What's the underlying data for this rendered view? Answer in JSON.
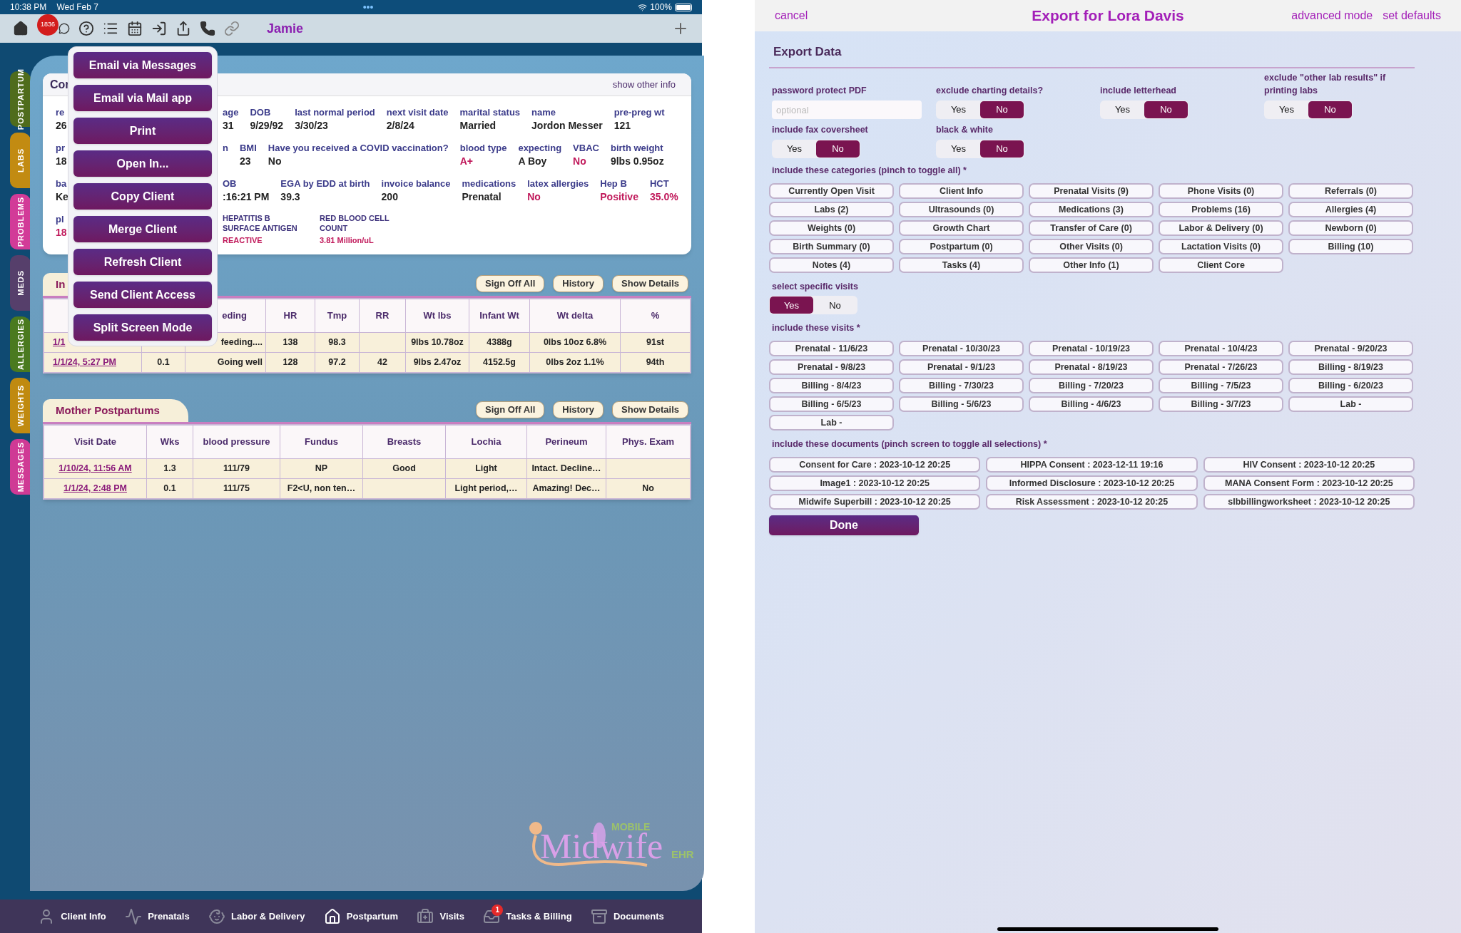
{
  "status_bar": {
    "time": "10:38 PM",
    "date": "Wed Feb 7",
    "dots": "•••",
    "battery": "100%"
  },
  "toolbar": {
    "badge": "1836",
    "user": "Jamie"
  },
  "side_tabs": [
    {
      "label": "POSTPARTUM",
      "color": "#4f6c1c"
    },
    {
      "label": "LABS",
      "color": "#c28b12"
    },
    {
      "label": "PROBLEMS",
      "color": "#d23b98"
    },
    {
      "label": "MEDS",
      "color": "#563f6b"
    },
    {
      "label": "ALLERGIES",
      "color": "#4a7a1f"
    },
    {
      "label": "WEIGHTS",
      "color": "#c08a10"
    },
    {
      "label": "MESSAGES",
      "color": "#cf3a95"
    }
  ],
  "client_card": {
    "title": "Cor",
    "link": "show other info",
    "lines": [
      [
        {
          "label": "re",
          "value": "26"
        },
        {
          "label": "age",
          "value": "31"
        },
        {
          "label": "DOB",
          "value": "9/29/92"
        },
        {
          "label": "last normal period",
          "value": "3/30/23"
        },
        {
          "label": "next visit date",
          "value": "2/8/24"
        },
        {
          "label": "marital status",
          "value": "Married"
        },
        {
          "label": "name",
          "value": "Jordon Messer"
        },
        {
          "label": "pre-preg wt",
          "value": "121"
        }
      ],
      [
        {
          "label": "pr",
          "value": "18"
        },
        {
          "label": "n"
        },
        {
          "label": "BMI",
          "value": "23"
        },
        {
          "label": "Have you received a COVID vaccination?",
          "value": "No"
        },
        {
          "label": "blood type",
          "value": "A+",
          "alert": true
        },
        {
          "label": "expecting",
          "value": "A Boy"
        },
        {
          "label": "VBAC",
          "value": "No",
          "alert": true
        },
        {
          "label": "birth weight",
          "value": "9lbs 0.95oz"
        }
      ],
      [
        {
          "label": "ba",
          "value": "Ke"
        },
        {
          "label": "OB",
          "value": ":16:21 PM"
        },
        {
          "label": "EGA by EDD at birth",
          "value": "39.3"
        },
        {
          "label": "invoice balance",
          "value": "200"
        },
        {
          "label": "medications",
          "value": "Prenatal"
        },
        {
          "label": "latex allergies",
          "value": "No",
          "alert": true
        },
        {
          "label": "Hep B",
          "value": "Positive",
          "alert": true
        },
        {
          "label": "HCT",
          "value": "35.0%",
          "alert": true
        }
      ],
      [
        {
          "label": "pl",
          "value": "18",
          "alert": true
        },
        {
          "label": "HEPATITIS B SURFACE ANTIGEN",
          "value": "REACTIVE",
          "alert": true,
          "kind": "lab"
        },
        {
          "label": "RED BLOOD CELL COUNT",
          "value": "3.81 Million/uL",
          "alert": true,
          "kind": "lab"
        }
      ]
    ]
  },
  "share_menu": [
    "Email via Messages",
    "Email via Mail app",
    "Print",
    "Open In...",
    "Copy Client",
    "Merge Client",
    "Refresh Client",
    "Send Client Access",
    "Split Screen Mode"
  ],
  "infant_table": {
    "title": "In",
    "buttons": [
      "Sign Off All",
      "History",
      "Show Details"
    ],
    "columns": [
      null,
      null,
      "eding",
      "HR",
      "Tmp",
      "RR",
      "Wt lbs",
      "Infant Wt",
      "Wt delta",
      "%"
    ],
    "rows": [
      [
        "1/1",
        null,
        "feeding....",
        "138",
        "98.3",
        null,
        "9lbs 10.78oz",
        "4388g",
        "0lbs 10oz 6.8%",
        "91st"
      ],
      [
        "1/1/24, 5:27 PM",
        "0.1",
        "Going well",
        "128",
        "97.2",
        "42",
        "9lbs 2.47oz",
        "4152.5g",
        "0lbs 2oz 1.1%",
        "94th"
      ]
    ]
  },
  "mother_table": {
    "title": "Mother Postpartums",
    "buttons": [
      "Sign Off All",
      "History",
      "Show Details"
    ],
    "columns": [
      "Visit Date",
      "Wks",
      "blood pressure",
      "Fundus",
      "Breasts",
      "Lochia",
      "Perineum",
      "Phys. Exam"
    ],
    "rows": [
      [
        "1/10/24, 11:56 AM",
        "1.3",
        "111/79",
        "NP",
        "Good",
        "Light",
        "Intact. Decline…",
        null
      ],
      [
        "1/1/24, 2:48 PM",
        "0.1",
        "111/75",
        "F2<U, non ten…",
        null,
        "Light period,…",
        "Amazing! Dec…",
        "No"
      ]
    ]
  },
  "logo": {
    "top": "MOBILE",
    "main": "Midwife",
    "side": "EHR"
  },
  "bottom_tabs": [
    {
      "label": "Client Info",
      "selected": false
    },
    {
      "label": "Prenatals",
      "selected": false
    },
    {
      "label": "Labor & Delivery",
      "selected": false
    },
    {
      "label": "Postpartum",
      "selected": true
    },
    {
      "label": "Visits",
      "selected": false
    },
    {
      "label": "Tasks & Billing",
      "selected": false,
      "badge": "1"
    },
    {
      "label": "Documents",
      "selected": false
    }
  ],
  "export": {
    "cancel": "cancel",
    "title": "Export for Lora Davis",
    "advanced": "advanced mode",
    "defaults": "set defaults",
    "heading": "Export Data",
    "password": {
      "label": "password protect PDF",
      "placeholder": "optional"
    },
    "toggles": [
      {
        "label": "exclude charting details?",
        "options": [
          {
            "label": "Yes",
            "selected": false
          },
          {
            "label": "No",
            "selected": true
          }
        ]
      },
      {
        "label": "include letterhead",
        "options": [
          {
            "label": "Yes",
            "selected": false
          },
          {
            "label": "No",
            "selected": true
          }
        ]
      },
      {
        "label": "exclude \"other lab results\" if printing labs",
        "options": [
          {
            "label": "Yes",
            "selected": false
          },
          {
            "label": "No",
            "selected": true
          }
        ]
      },
      {
        "label": "include fax coversheet",
        "options": [
          {
            "label": "Yes",
            "selected": false
          },
          {
            "label": "No",
            "selected": true
          }
        ]
      },
      {
        "label": "black & white",
        "options": [
          {
            "label": "Yes",
            "selected": false
          },
          {
            "label": "No",
            "selected": true
          }
        ]
      }
    ],
    "categories_label": "include these categories (pinch to toggle all) *",
    "categories": [
      "Currently Open Visit",
      "Client Info",
      "Prenatal Visits (9)",
      "Phone Visits (0)",
      "Referrals (0)",
      "Labs (2)",
      "Ultrasounds (0)",
      "Medications (3)",
      "Problems (16)",
      "Allergies (4)",
      "Weights (0)",
      "Growth Chart",
      "Transfer of Care (0)",
      "Labor & Delivery (0)",
      "Newborn (0)",
      "Birth Summary (0)",
      "Postpartum (0)",
      "Other Visits (0)",
      "Lactation Visits (0)",
      "Billing (10)",
      "Notes (4)",
      "Tasks (4)",
      "Other Info (1)",
      "Client Core"
    ],
    "specific": {
      "label": "select specific visits",
      "options": [
        {
          "label": "Yes",
          "selected": true
        },
        {
          "label": "No",
          "selected": false
        }
      ]
    },
    "visits_label": "include these visits *",
    "visits": [
      "Prenatal - 11/6/23",
      "Prenatal - 10/30/23",
      "Prenatal - 10/19/23",
      "Prenatal - 10/4/23",
      "Prenatal - 9/20/23",
      "Prenatal - 9/8/23",
      "Prenatal - 9/1/23",
      "Prenatal - 8/19/23",
      "Prenatal - 7/26/23",
      "Billing - 8/19/23",
      "Billing - 8/4/23",
      "Billing - 7/30/23",
      "Billing - 7/20/23",
      "Billing - 7/5/23",
      "Billing - 6/20/23",
      "Billing - 6/5/23",
      "Billing - 5/6/23",
      "Billing - 4/6/23",
      "Billing - 3/7/23",
      "Lab -",
      "Lab -"
    ],
    "documents_label": "include these documents (pinch screen to toggle all selections) *",
    "documents": [
      "Consent for Care : 2023-10-12 20:25",
      "HIPPA Consent : 2023-12-11 19:16",
      "HIV Consent : 2023-10-12 20:25",
      "Image1 : 2023-10-12 20:25",
      "Informed Disclosure : 2023-10-12 20:25",
      "MANA Consent Form : 2023-10-12 20:25",
      "Midwife Superbill : 2023-10-12 20:25",
      "Risk Assessment : 2023-10-12 20:25",
      "slbbillingworksheet : 2023-10-12 20:25"
    ],
    "done": "Done"
  }
}
